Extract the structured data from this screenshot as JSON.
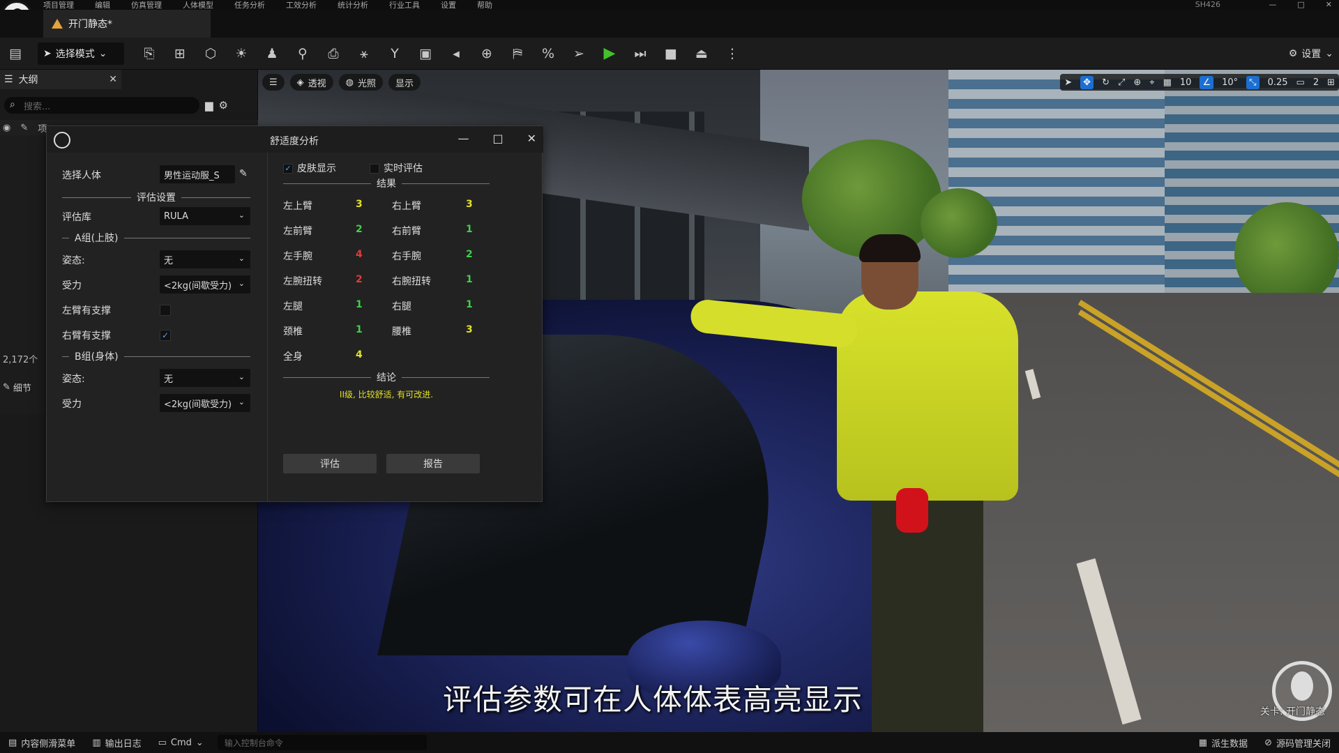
{
  "app": {
    "menu": [
      "项目管理",
      "编辑",
      "仿真管理",
      "人体模型",
      "任务分析",
      "工效分析",
      "统计分析",
      "行业工具",
      "设置",
      "帮助"
    ],
    "project_name": "SH426",
    "window_controls": [
      "—",
      "□",
      "✕"
    ]
  },
  "tab": {
    "title": "开门静态*"
  },
  "toolbar": {
    "mode_label": "选择模式",
    "settings_label": "设置"
  },
  "outliner": {
    "title": "大纲",
    "close": "✕",
    "search_placeholder": "搜索...",
    "column_label": "项",
    "item_count": "2,172个",
    "details_tab": "细节"
  },
  "viewport": {
    "pill_lit": "透视",
    "pill_lighting": "光照",
    "pill_show": "显示",
    "snap_grid": "10",
    "snap_angle": "10°",
    "snap_scale": "0.25",
    "camera_speed": "2",
    "subtitle": "评估参数可在人体体表高亮显示",
    "level_label": "关卡: 开门静态"
  },
  "dialog": {
    "title": "舒适度分析",
    "controls": [
      "—",
      "□",
      "✕"
    ],
    "select_human_label": "选择人体",
    "select_human_value": "男性运动服_S",
    "eval_settings": "评估设置",
    "eval_lib_label": "评估库",
    "eval_lib_value": "RULA",
    "group_a": "A组(上肢)",
    "a_posture_label": "姿态:",
    "a_posture_value": "无",
    "a_force_label": "受力",
    "a_force_value": "<2kg(间歇受力)",
    "left_arm_support": "左臂有支撑",
    "right_arm_support": "右臂有支撑",
    "group_b": "B组(身体)",
    "b_posture_label": "姿态:",
    "b_posture_value": "无",
    "b_force_label": "受力",
    "b_force_value": "<2kg(间歇受力)",
    "skin_display": "皮肤显示",
    "realtime_eval": "实时评估",
    "results_header": "结果",
    "results": [
      {
        "left_label": "左上臂",
        "left_value": "3",
        "right_label": "右上臂",
        "right_value": "3"
      },
      {
        "left_label": "左前臂",
        "left_value": "2",
        "right_label": "右前臂",
        "right_value": "1"
      },
      {
        "left_label": "左手腕",
        "left_value": "4",
        "right_label": "右手腕",
        "right_value": "2"
      },
      {
        "left_label": "左腕扭转",
        "left_value": "2",
        "right_label": "右腕扭转",
        "right_value": "1"
      },
      {
        "left_label": "左腿",
        "left_value": "1",
        "right_label": "右腿",
        "right_value": "1"
      },
      {
        "left_label": "颈椎",
        "left_value": "1",
        "right_label": "腰椎",
        "right_value": "3"
      }
    ],
    "total_label": "全身",
    "total_value": "4",
    "conclusion_header": "结论",
    "conclusion_text": "II级, 比较舒适, 有可改进.",
    "eval_button": "评估",
    "report_button": "报告"
  },
  "colors": {
    "score_3": "#e1e12a",
    "score_2": "#3fd14a",
    "score_1": "#3fd14a",
    "score_4_red": "#e23a3a",
    "score_4_total": "#e1e12a",
    "accent_blue": "#1c6fd1",
    "play_green": "#43c12b"
  },
  "statusbar": {
    "content_drawer": "内容侧滑菜单",
    "output_log": "输出日志",
    "cmd": "Cmd",
    "cmd_placeholder": "输入控制台命令",
    "derived_data": "派生数据",
    "source_control": "源码管理关闭"
  }
}
